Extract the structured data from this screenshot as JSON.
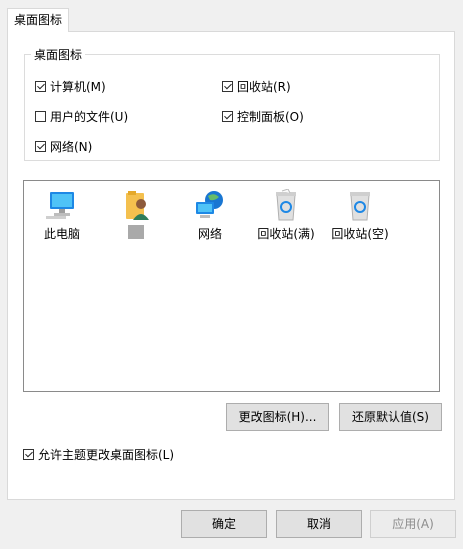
{
  "tab": {
    "label": "桌面图标"
  },
  "group": {
    "title": "桌面图标",
    "items": [
      {
        "label": "计算机(M)",
        "checked": true
      },
      {
        "label": "回收站(R)",
        "checked": true
      },
      {
        "label": "用户的文件(U)",
        "checked": false
      },
      {
        "label": "控制面板(O)",
        "checked": true
      },
      {
        "label": "网络(N)",
        "checked": true
      }
    ]
  },
  "icons": [
    {
      "label": "此电脑",
      "icon": "computer-icon"
    },
    {
      "label": "",
      "icon": "user-folder-icon"
    },
    {
      "label": "网络",
      "icon": "network-icon"
    },
    {
      "label": "回收站(满)",
      "icon": "recycle-bin-full-icon"
    },
    {
      "label": "回收站(空)",
      "icon": "recycle-bin-empty-icon"
    }
  ],
  "buttons": {
    "change_icon": "更改图标(H)...",
    "restore_default": "还原默认值(S)"
  },
  "allow_themes": {
    "label": "允许主题更改桌面图标(L)",
    "checked": true
  },
  "dialog_buttons": {
    "ok": "确定",
    "cancel": "取消",
    "apply": "应用(A)"
  },
  "colors": {
    "selection_gray": "#a9a9a9",
    "disabled_text": "#8c8c8c"
  }
}
